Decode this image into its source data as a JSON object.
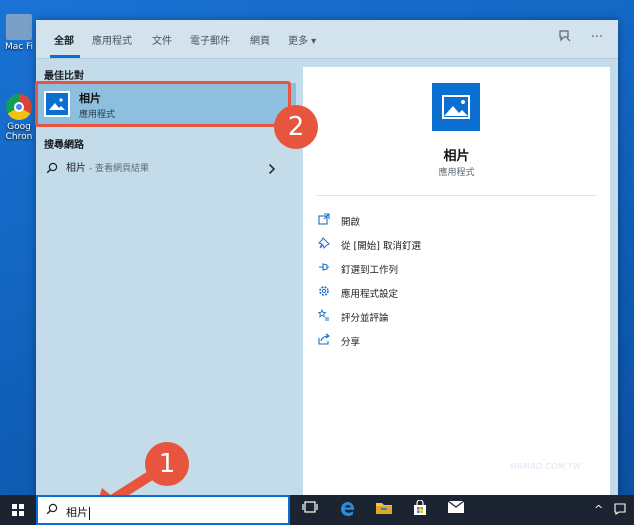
{
  "desktop": {
    "icons": [
      {
        "label": "Mac Fi",
        "icon": "folder-icon"
      },
      {
        "label": "Goog Chron",
        "icon": "chrome-icon"
      }
    ]
  },
  "search_panel": {
    "tabs": [
      {
        "label": "全部",
        "active": true
      },
      {
        "label": "應用程式"
      },
      {
        "label": "文件"
      },
      {
        "label": "電子郵件"
      },
      {
        "label": "網頁"
      },
      {
        "label": "更多 ▾"
      }
    ],
    "top_icons": [
      "feedback-icon",
      "more-options-icon"
    ],
    "more_options_glyph": "···",
    "best_match_heading": "最佳比對",
    "best_match": {
      "title": "相片",
      "subtitle": "應用程式",
      "icon": "photos-app-icon"
    },
    "web_heading": "搜尋網路",
    "web_result": {
      "query": "相片",
      "suffix": " - 查看網頁結果"
    },
    "details": {
      "title": "相片",
      "subtitle": "應用程式",
      "actions": [
        {
          "label": "開啟",
          "icon": "open-icon"
        },
        {
          "label": "從 [開始] 取消釘選",
          "icon": "unpin-icon"
        },
        {
          "label": "釘選到工作列",
          "icon": "pin-taskbar-icon"
        },
        {
          "label": "應用程式設定",
          "icon": "gear-icon"
        },
        {
          "label": "評分並評論",
          "icon": "rate-icon"
        },
        {
          "label": "分享",
          "icon": "share-icon"
        }
      ]
    }
  },
  "annotations": {
    "step1": "1",
    "step2": "2"
  },
  "watermark": "MRMAD.COM.TW",
  "taskbar": {
    "search_value": "相片",
    "icons": [
      "task-view-icon",
      "edge-icon",
      "file-explorer-icon",
      "store-icon",
      "mail-icon"
    ],
    "tray_chevron": "^"
  },
  "colors": {
    "accent": "#0a6fd1",
    "annotation": "#e8553f",
    "selection": "#8ebfdf"
  }
}
